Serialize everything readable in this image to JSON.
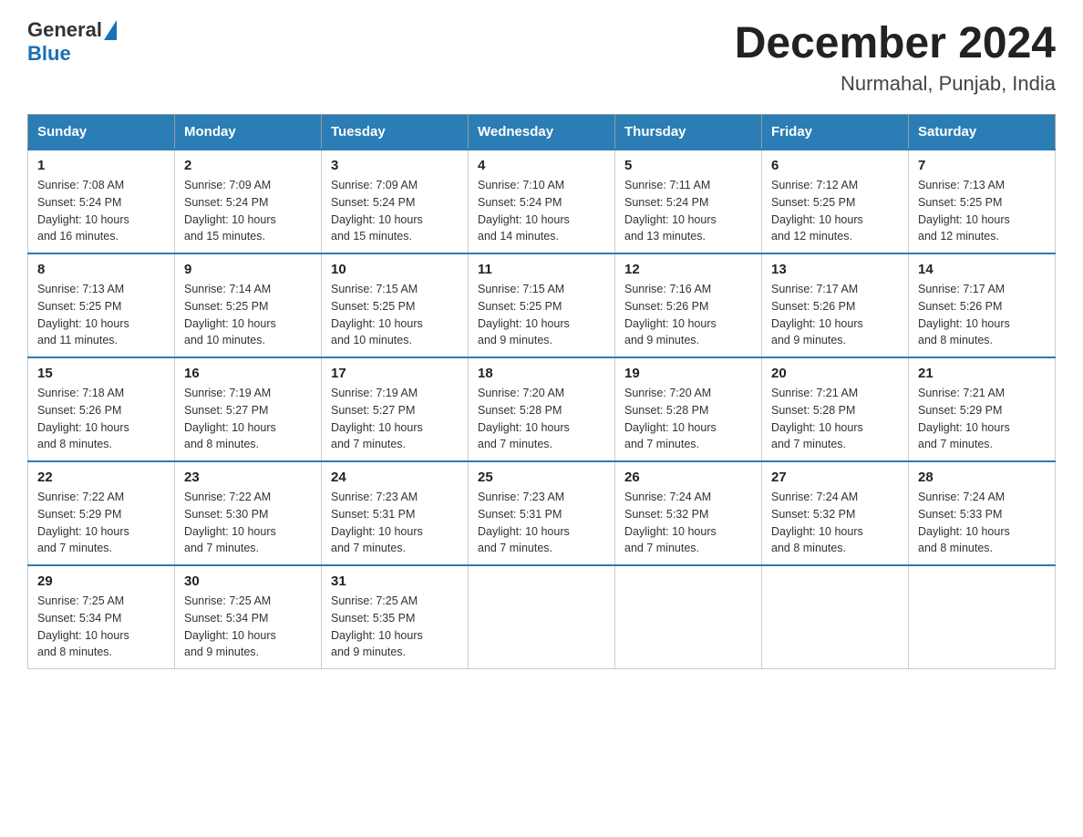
{
  "header": {
    "logo_general": "General",
    "logo_blue": "Blue",
    "month_title": "December 2024",
    "location": "Nurmahal, Punjab, India"
  },
  "days_of_week": [
    "Sunday",
    "Monday",
    "Tuesday",
    "Wednesday",
    "Thursday",
    "Friday",
    "Saturday"
  ],
  "weeks": [
    [
      {
        "day": "1",
        "sunrise": "7:08 AM",
        "sunset": "5:24 PM",
        "daylight": "10 hours and 16 minutes."
      },
      {
        "day": "2",
        "sunrise": "7:09 AM",
        "sunset": "5:24 PM",
        "daylight": "10 hours and 15 minutes."
      },
      {
        "day": "3",
        "sunrise": "7:09 AM",
        "sunset": "5:24 PM",
        "daylight": "10 hours and 15 minutes."
      },
      {
        "day": "4",
        "sunrise": "7:10 AM",
        "sunset": "5:24 PM",
        "daylight": "10 hours and 14 minutes."
      },
      {
        "day": "5",
        "sunrise": "7:11 AM",
        "sunset": "5:24 PM",
        "daylight": "10 hours and 13 minutes."
      },
      {
        "day": "6",
        "sunrise": "7:12 AM",
        "sunset": "5:25 PM",
        "daylight": "10 hours and 12 minutes."
      },
      {
        "day": "7",
        "sunrise": "7:13 AM",
        "sunset": "5:25 PM",
        "daylight": "10 hours and 12 minutes."
      }
    ],
    [
      {
        "day": "8",
        "sunrise": "7:13 AM",
        "sunset": "5:25 PM",
        "daylight": "10 hours and 11 minutes."
      },
      {
        "day": "9",
        "sunrise": "7:14 AM",
        "sunset": "5:25 PM",
        "daylight": "10 hours and 10 minutes."
      },
      {
        "day": "10",
        "sunrise": "7:15 AM",
        "sunset": "5:25 PM",
        "daylight": "10 hours and 10 minutes."
      },
      {
        "day": "11",
        "sunrise": "7:15 AM",
        "sunset": "5:25 PM",
        "daylight": "10 hours and 9 minutes."
      },
      {
        "day": "12",
        "sunrise": "7:16 AM",
        "sunset": "5:26 PM",
        "daylight": "10 hours and 9 minutes."
      },
      {
        "day": "13",
        "sunrise": "7:17 AM",
        "sunset": "5:26 PM",
        "daylight": "10 hours and 9 minutes."
      },
      {
        "day": "14",
        "sunrise": "7:17 AM",
        "sunset": "5:26 PM",
        "daylight": "10 hours and 8 minutes."
      }
    ],
    [
      {
        "day": "15",
        "sunrise": "7:18 AM",
        "sunset": "5:26 PM",
        "daylight": "10 hours and 8 minutes."
      },
      {
        "day": "16",
        "sunrise": "7:19 AM",
        "sunset": "5:27 PM",
        "daylight": "10 hours and 8 minutes."
      },
      {
        "day": "17",
        "sunrise": "7:19 AM",
        "sunset": "5:27 PM",
        "daylight": "10 hours and 7 minutes."
      },
      {
        "day": "18",
        "sunrise": "7:20 AM",
        "sunset": "5:28 PM",
        "daylight": "10 hours and 7 minutes."
      },
      {
        "day": "19",
        "sunrise": "7:20 AM",
        "sunset": "5:28 PM",
        "daylight": "10 hours and 7 minutes."
      },
      {
        "day": "20",
        "sunrise": "7:21 AM",
        "sunset": "5:28 PM",
        "daylight": "10 hours and 7 minutes."
      },
      {
        "day": "21",
        "sunrise": "7:21 AM",
        "sunset": "5:29 PM",
        "daylight": "10 hours and 7 minutes."
      }
    ],
    [
      {
        "day": "22",
        "sunrise": "7:22 AM",
        "sunset": "5:29 PM",
        "daylight": "10 hours and 7 minutes."
      },
      {
        "day": "23",
        "sunrise": "7:22 AM",
        "sunset": "5:30 PM",
        "daylight": "10 hours and 7 minutes."
      },
      {
        "day": "24",
        "sunrise": "7:23 AM",
        "sunset": "5:31 PM",
        "daylight": "10 hours and 7 minutes."
      },
      {
        "day": "25",
        "sunrise": "7:23 AM",
        "sunset": "5:31 PM",
        "daylight": "10 hours and 7 minutes."
      },
      {
        "day": "26",
        "sunrise": "7:24 AM",
        "sunset": "5:32 PM",
        "daylight": "10 hours and 7 minutes."
      },
      {
        "day": "27",
        "sunrise": "7:24 AM",
        "sunset": "5:32 PM",
        "daylight": "10 hours and 8 minutes."
      },
      {
        "day": "28",
        "sunrise": "7:24 AM",
        "sunset": "5:33 PM",
        "daylight": "10 hours and 8 minutes."
      }
    ],
    [
      {
        "day": "29",
        "sunrise": "7:25 AM",
        "sunset": "5:34 PM",
        "daylight": "10 hours and 8 minutes."
      },
      {
        "day": "30",
        "sunrise": "7:25 AM",
        "sunset": "5:34 PM",
        "daylight": "10 hours and 9 minutes."
      },
      {
        "day": "31",
        "sunrise": "7:25 AM",
        "sunset": "5:35 PM",
        "daylight": "10 hours and 9 minutes."
      },
      null,
      null,
      null,
      null
    ]
  ]
}
